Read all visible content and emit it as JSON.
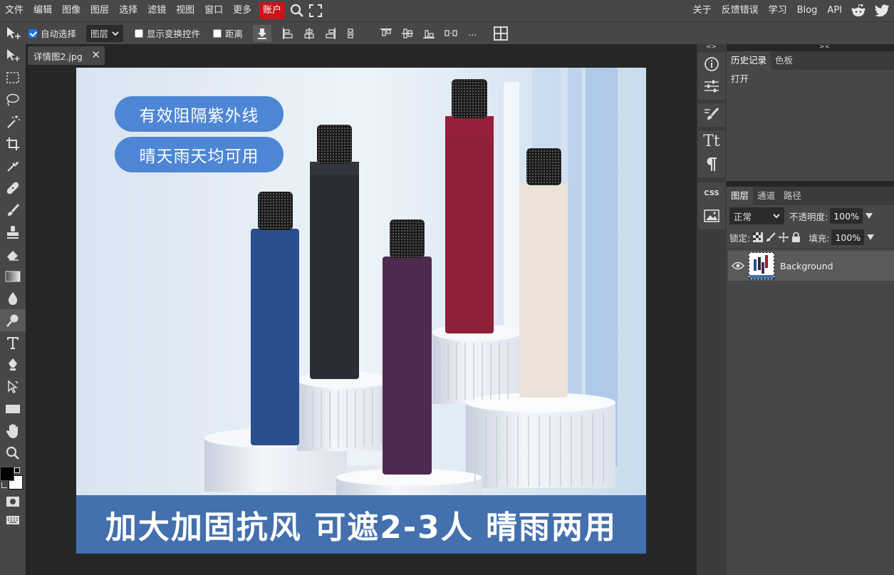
{
  "menu": {
    "items": [
      "文件",
      "编辑",
      "图像",
      "图层",
      "选择",
      "滤镜",
      "视图",
      "窗口",
      "更多"
    ],
    "account": "账户",
    "right_items": [
      "关于",
      "反馈错误",
      "学习",
      "Blog",
      "API"
    ]
  },
  "options": {
    "auto_select_label": "自动选择",
    "auto_select_checked": true,
    "target_select": "图层",
    "show_transform_label": "显示变换控件",
    "distance_label": "距离",
    "more": "..."
  },
  "document": {
    "tab_title": "详情图2.jpg",
    "close_glyph": "✕"
  },
  "image": {
    "pill1": "有效阻隔紫外线",
    "pill2": "晴天雨天均可用",
    "banner": "加大加固抗风 可遮2-3人 晴雨两用"
  },
  "panel_strip": {
    "collapse_left": "<>",
    "collapse_right": "><",
    "css_label": "CSS",
    "text_label": "Tt"
  },
  "history_panel": {
    "tabs": [
      "历史记录",
      "色板"
    ],
    "active_tab": "历史记录",
    "entries": [
      "打开"
    ]
  },
  "layers_panel": {
    "tabs": [
      "图层",
      "通道",
      "路径"
    ],
    "blend_mode": "正常",
    "opacity_label": "不透明度:",
    "opacity_value": "100%",
    "lock_label": "锁定:",
    "fill_label": "填充:",
    "fill_value": "100%",
    "layers": [
      {
        "name": "Background",
        "visible": true
      }
    ]
  },
  "colors": {
    "accent": "#c8141c",
    "pill": "#4d86d4",
    "banner": "#4470ad",
    "umbrella_blue": "#2b4f8e",
    "umbrella_black": "#2a2c36",
    "umbrella_red": "#8e2038",
    "umbrella_purple": "#4e2a4e",
    "umbrella_beige": "#ece2d8"
  }
}
